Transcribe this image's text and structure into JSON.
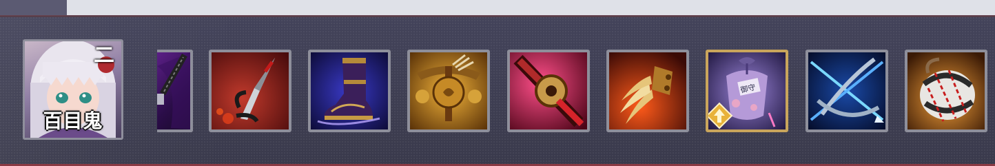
{
  "hero": {
    "name": "百目鬼",
    "grade": "二",
    "portrait_icon": "hero-portrait"
  },
  "items": [
    {
      "icon": "katana-item-icon"
    },
    {
      "icon": "blood-dagger-item-icon"
    },
    {
      "icon": "purple-boots-item-icon"
    },
    {
      "icon": "golden-crossbow-item-icon"
    },
    {
      "icon": "crimson-katana-item-icon"
    },
    {
      "icon": "golden-claw-item-icon"
    },
    {
      "icon": "omamori-charm-item-icon",
      "charm_text": "御守",
      "highlighted": true,
      "badge": "upgrade-arrow-icon"
    },
    {
      "icon": "crossed-bows-item-icon"
    },
    {
      "icon": "bound-rope-item-icon"
    }
  ],
  "colors": {
    "panel": "#40404f",
    "slot_border": "#8e8f9b",
    "highlight_border": "#c9a55c",
    "bottom_accent": "#8a3a44"
  }
}
